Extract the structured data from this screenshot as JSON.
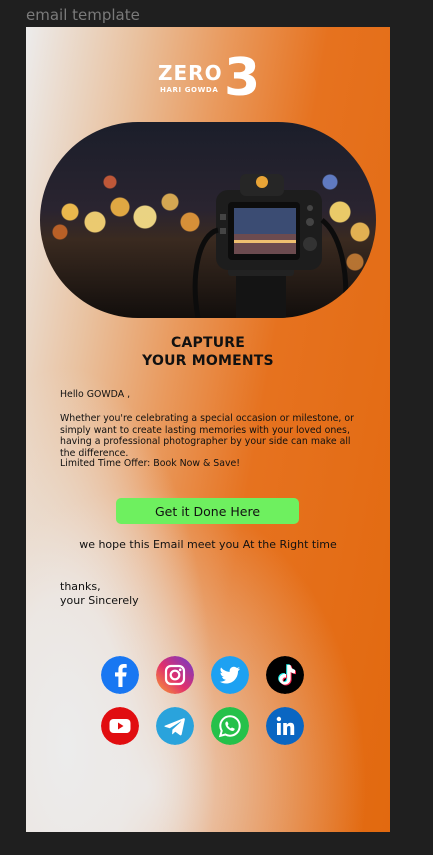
{
  "canvas": {
    "frame_label": "email template"
  },
  "brand": {
    "logo_word": "ZERO",
    "logo_sub": "HARI GOWDA",
    "logo_digit": "3"
  },
  "email": {
    "title_line1": "CAPTURE",
    "title_line2": "YOUR MOMENTS",
    "greeting": "Hello GOWDA ,",
    "paragraph": "Whether you're celebrating a special occasion or milestone, or simply want to create lasting memories with your loved ones, having a professional photographer by your side can make all the difference.",
    "offer": "Limited Time Offer: Book Now & Save!",
    "cta_label": "Get it Done Here",
    "hope_text": "we hope this Email meet you At the Right time",
    "signoff_line1": "thanks,",
    "signoff_line2": "your Sincerely"
  },
  "social": {
    "row1": [
      "facebook-icon",
      "instagram-icon",
      "twitter-icon",
      "tiktok-icon"
    ],
    "row2": [
      "youtube-icon",
      "telegram-icon",
      "whatsapp-icon",
      "linkedin-icon"
    ]
  },
  "colors": {
    "cta_bg": "#6ef05f",
    "orange": "#e26910",
    "facebook": "#1877f2",
    "twitter": "#1da1f2",
    "youtube": "#e10d10",
    "telegram": "#2aa3dc",
    "whatsapp": "#25c14a",
    "linkedin": "#0a66c2"
  }
}
